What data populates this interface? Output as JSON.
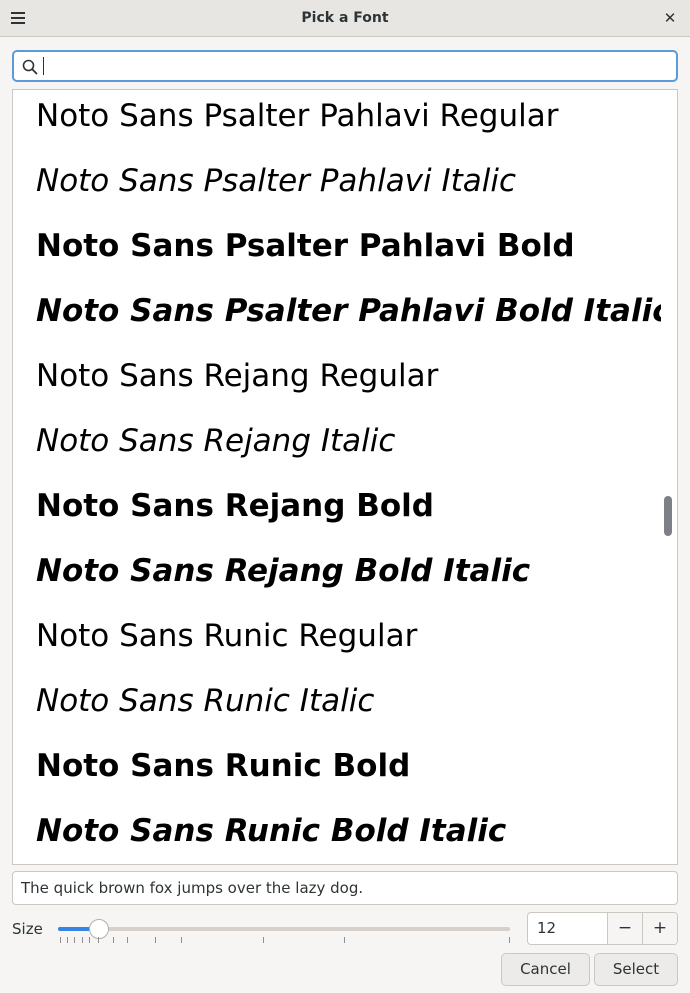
{
  "window": {
    "title": "Pick a Font"
  },
  "search": {
    "value": "",
    "placeholder": ""
  },
  "fonts": [
    {
      "label": "Noto Sans Psalter Pahlavi Regular",
      "style": "regular"
    },
    {
      "label": "Noto Sans Psalter Pahlavi Italic",
      "style": "italic"
    },
    {
      "label": "Noto Sans Psalter Pahlavi Bold",
      "style": "bold"
    },
    {
      "label": "Noto Sans Psalter Pahlavi Bold Italic",
      "style": "bold-italic"
    },
    {
      "label": "Noto Sans Rejang Regular",
      "style": "regular"
    },
    {
      "label": "Noto Sans Rejang Italic",
      "style": "italic"
    },
    {
      "label": "Noto Sans Rejang Bold",
      "style": "bold"
    },
    {
      "label": "Noto Sans Rejang Bold Italic",
      "style": "bold-italic"
    },
    {
      "label": "Noto Sans Runic Regular",
      "style": "regular"
    },
    {
      "label": "Noto Sans Runic Italic",
      "style": "italic"
    },
    {
      "label": "Noto Sans Runic Bold",
      "style": "bold"
    },
    {
      "label": "Noto Sans Runic Bold Italic",
      "style": "bold-italic"
    }
  ],
  "preview": {
    "text": "The quick brown fox jumps over the lazy dog."
  },
  "size": {
    "label": "Size",
    "value": "12",
    "slider_fraction": 0.09,
    "decrement_label": "−",
    "increment_label": "+"
  },
  "buttons": {
    "cancel": "Cancel",
    "select": "Select"
  },
  "icons": {
    "menu": "menu-icon",
    "close": "close-icon",
    "search": "search-icon"
  },
  "colors": {
    "accent": "#3584e4",
    "focus_border": "#5b9bd9"
  }
}
